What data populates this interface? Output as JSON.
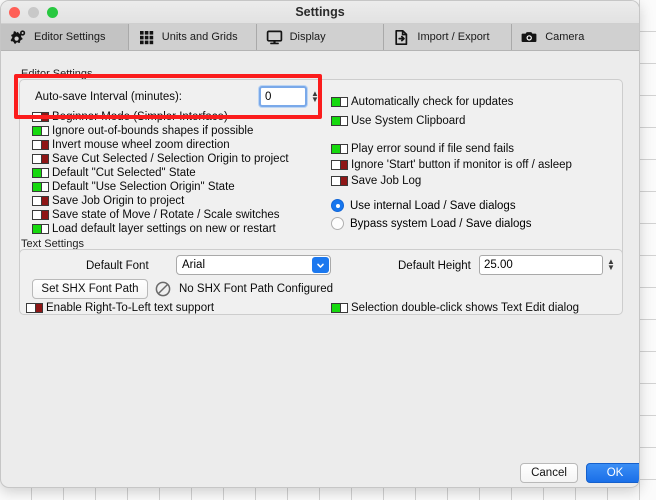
{
  "window": {
    "title": "Settings",
    "traffic_lights": [
      "close-button",
      "minimize-button",
      "zoom-button"
    ]
  },
  "tabs": [
    {
      "label": "Editor Settings",
      "icon": "gear-icon",
      "selected": true
    },
    {
      "label": "Units and Grids",
      "icon": "grid-dots-icon",
      "selected": false
    },
    {
      "label": "Display",
      "icon": "monitor-icon",
      "selected": false
    },
    {
      "label": "Import / Export",
      "icon": "document-import-icon",
      "selected": false
    },
    {
      "label": "Camera",
      "icon": "camera-icon",
      "selected": false
    }
  ],
  "editor_settings": {
    "group_label": "Editor Settings",
    "autosave": {
      "label": "Auto-save Interval (minutes):",
      "value": "0",
      "focused": true
    },
    "left_toggles": [
      {
        "label": "Beginner Mode (Simpler Interface)",
        "state": "off"
      },
      {
        "label": "Ignore out-of-bounds shapes if possible",
        "state": "on"
      },
      {
        "label": "Invert mouse wheel zoom direction",
        "state": "off"
      },
      {
        "label": "Save Cut Selected / Selection Origin to project",
        "state": "off"
      },
      {
        "label": "Default \"Cut Selected\" State",
        "state": "on"
      },
      {
        "label": "Default \"Use Selection Origin\" State",
        "state": "on"
      },
      {
        "label": "Save Job Origin to project",
        "state": "off"
      },
      {
        "label": "Save state of Move / Rotate / Scale switches",
        "state": "off"
      },
      {
        "label": "Load default layer settings on new or restart",
        "state": "on"
      }
    ],
    "right_toggles": [
      {
        "label": "Automatically check for updates",
        "state": "on"
      },
      {
        "label": "Use System Clipboard",
        "state": "on"
      },
      {
        "label": "Play error sound if file send fails",
        "state": "on"
      },
      {
        "label": "Ignore 'Start' button if monitor is off / asleep",
        "state": "off"
      },
      {
        "label": "Save Job Log",
        "state": "off"
      }
    ],
    "dialog_radios": [
      {
        "label": "Use internal Load / Save dialogs",
        "checked": true
      },
      {
        "label": "Bypass system Load / Save dialogs",
        "checked": false
      }
    ]
  },
  "text_settings": {
    "group_label": "Text Settings",
    "default_font_label": "Default Font",
    "default_font_value": "Arial",
    "default_height_label": "Default Height",
    "default_height_value": "25.00",
    "shx_button_label": "Set SHX Font Path",
    "shx_status": "No SHX Font Path Configured",
    "shx_status_icon": "no-entry-icon",
    "rtl_toggle": {
      "label": "Enable Right-To-Left text support",
      "state": "off"
    },
    "dblclick_toggle": {
      "label": "Selection double-click shows Text Edit dialog",
      "state": "on"
    }
  },
  "footer": {
    "cancel_label": "Cancel",
    "ok_label": "OK"
  },
  "annotation": {
    "type": "red-highlight-rectangle",
    "color": "#fb1c1c"
  }
}
